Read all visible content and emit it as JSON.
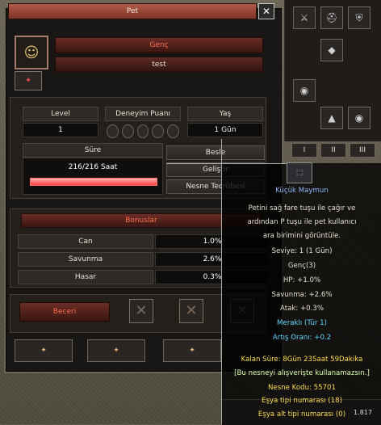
{
  "window": {
    "title": "Pet",
    "close_label": "✕",
    "pet_name": "Genç",
    "pet_owner": "test"
  },
  "stats": {
    "level_label": "Level",
    "level_value": "1",
    "exp_label": "Deneyim Puanı",
    "age_label": "Yaş",
    "age_value": "1 Gün",
    "duration_label": "Süre",
    "duration_value": "216/216 Saat",
    "duration_fill": 1.0
  },
  "actions": {
    "feed": "Besle",
    "develop": "Geliştir",
    "item_exp": "Nesne Tecrübesi"
  },
  "bonuses": {
    "title": "Bonuslar",
    "rows": [
      {
        "name": "Can",
        "value": "1.0%"
      },
      {
        "name": "Savunma",
        "value": "2.6%"
      },
      {
        "name": "Hasar",
        "value": "0.3%"
      }
    ]
  },
  "skills": {
    "title": "Beceri"
  },
  "tabs": [
    {
      "label": "✦"
    },
    {
      "label": "✦"
    },
    {
      "label": "✦"
    }
  ],
  "inventory": {
    "tabs": [
      "I",
      "II",
      "III"
    ]
  },
  "tooltip": {
    "name": "Küçük Maymun",
    "desc1": "Petini sağ fare tuşu ile çağır ve",
    "desc2": "ardından P tuşu ile pet kullanıcı",
    "desc3": "ara birimini görüntüle.",
    "level": "Seviye: 1 (1 Gün)",
    "stage": "Genç(3)",
    "hp": "HP: +1.0%",
    "def": "Savunma: +2.6%",
    "atk": "Atak: +0.3%",
    "curious": "Meraklı (Tür 1)",
    "growth": "Artış Oranı: +0.2",
    "remaining": "Kalan Süre: 8Gün 23Saat 59Dakika",
    "shop": "[Bu nesneyi alışverişte kullanamazsın.]",
    "code": "Nesne Kodu: 55701",
    "type": "Eşya tipi numarası (18)",
    "subtype": "Eşya alt tipi numarası (0)",
    "bottom_value": "1.817"
  },
  "colors": {
    "title_red": "#8c3b31",
    "accent_orange": "#ff6f4d",
    "tooltip_blue": "#8fb7ff",
    "tooltip_yellow": "#ffdd4f"
  }
}
